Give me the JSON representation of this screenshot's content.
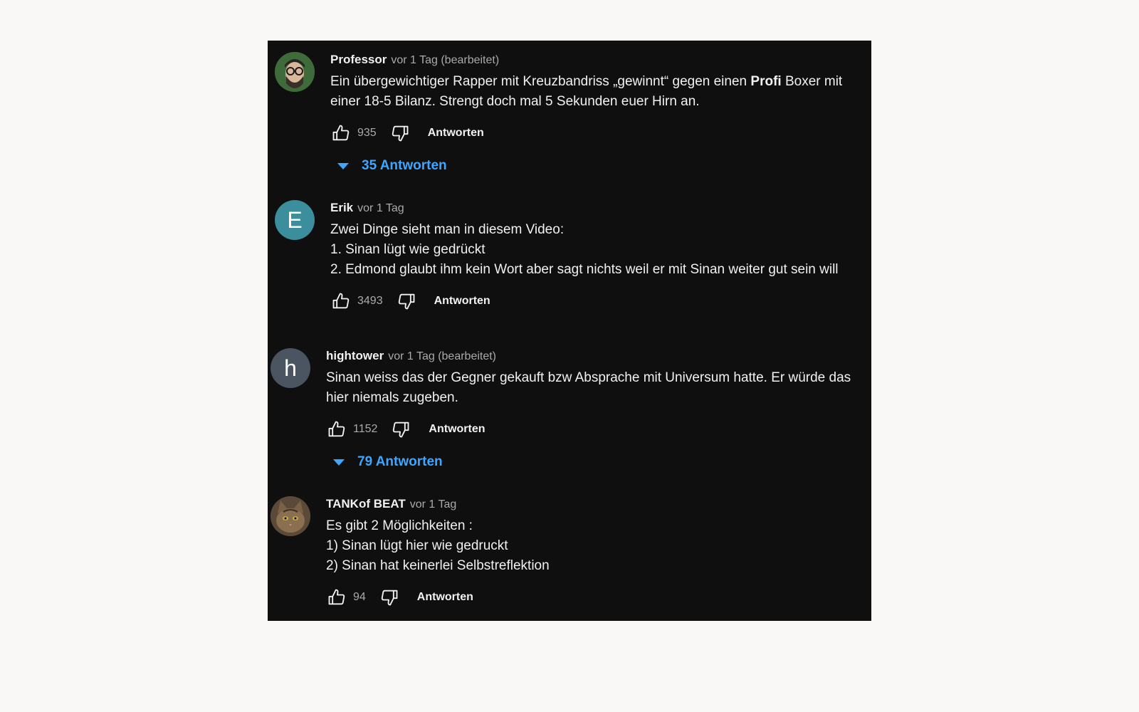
{
  "comments": [
    {
      "author": "Professor",
      "meta": "vor 1 Tag (bearbeitet)",
      "avatar": {
        "kind": "image",
        "description_icon": "person-glasses-beard-avatar",
        "bg": "#3f6b3a"
      },
      "lines": [
        {
          "before": "Ein übergewichtiger Rapper mit Kreuzbandriss „gewinnt“ gegen einen ",
          "bold": "Profi",
          "after": " Boxer mit"
        },
        "einer 18-5 Bilanz. Strengt doch mal 5 Sekunden euer Hirn an."
      ],
      "likes": "935",
      "reply_label": "Antworten",
      "replies": "35 Antworten"
    },
    {
      "author": "Erik",
      "meta": "vor 1 Tag",
      "avatar": {
        "kind": "letter",
        "letter": "E",
        "bg": "#3b8e9c"
      },
      "lines": [
        "Zwei Dinge sieht man in diesem Video:",
        "1. Sinan lügt wie gedrückt",
        "2. Edmond glaubt ihm kein Wort aber sagt nichts weil er mit Sinan weiter gut sein will"
      ],
      "likes": "3493",
      "reply_label": "Antworten"
    },
    {
      "author": "hightower",
      "meta": "vor 1 Tag (bearbeitet)",
      "avatar": {
        "kind": "letter",
        "letter": "h",
        "bg": "#4a5561"
      },
      "lines": [
        "Sinan weiss das der Gegner gekauft bzw Absprache mit Universum hatte. Er würde das",
        "hier niemals zugeben."
      ],
      "likes": "1152",
      "reply_label": "Antworten",
      "replies": "79 Antworten"
    },
    {
      "author": "TANKof BEAT",
      "meta": "vor 1 Tag",
      "avatar": {
        "kind": "image",
        "description_icon": "cat-face-avatar",
        "bg": "#6b5a45"
      },
      "lines": [
        "Es gibt 2 Möglichkeiten :",
        "1) Sinan lügt hier wie gedruckt",
        "2) Sinan hat keinerlei Selbstreflektion"
      ],
      "likes": "94",
      "reply_label": "Antworten"
    }
  ],
  "colors": {
    "panel_bg": "#0f0f0f",
    "text": "#f1f1f1",
    "secondary": "#aaaaaa",
    "link": "#3ea6ff"
  }
}
